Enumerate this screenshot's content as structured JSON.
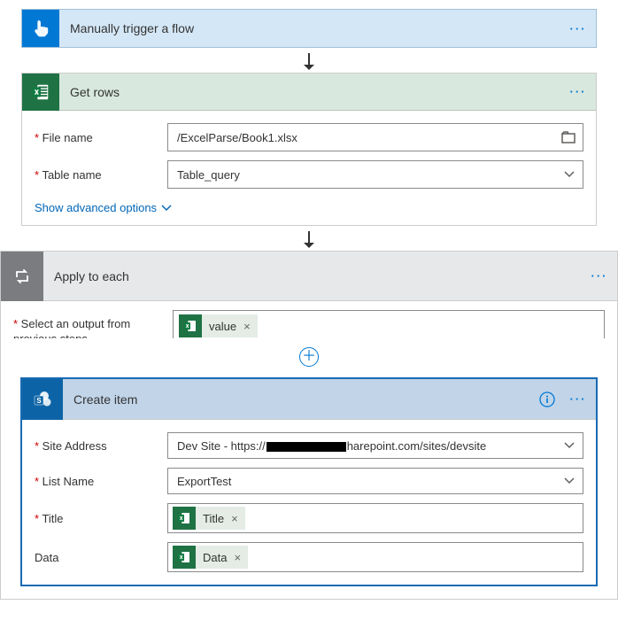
{
  "trigger": {
    "title": "Manually trigger a flow"
  },
  "getRows": {
    "title": "Get rows",
    "fileNameLabel": "File name",
    "fileNameValue": "/ExcelParse/Book1.xlsx",
    "tableNameLabel": "Table name",
    "tableNameValue": "Table_query",
    "advanced": "Show advanced options"
  },
  "applyEach": {
    "title": "Apply to each",
    "selectLabel": "Select an output from previous steps",
    "tokenValue": "value"
  },
  "createItem": {
    "title": "Create item",
    "siteLabel": "Site Address",
    "sitePrefix": "Dev Site - https://",
    "siteSuffix": "harepoint.com/sites/devsite",
    "listLabel": "List Name",
    "listValue": "ExportTest",
    "titleLabel": "Title",
    "titleToken": "Title",
    "dataLabel": "Data",
    "dataToken": "Data"
  }
}
